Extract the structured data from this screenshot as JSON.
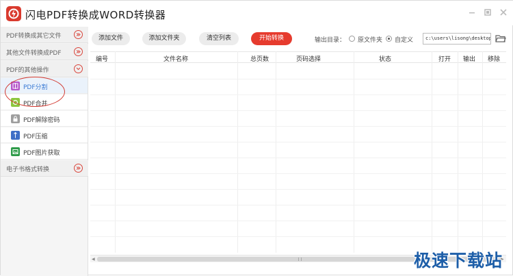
{
  "app": {
    "title": "闪电PDF转换成WORD转换器"
  },
  "sidebar": {
    "sections": [
      {
        "label": "PDF转换成其它文件"
      },
      {
        "label": "其他文件转换成PDF"
      },
      {
        "label": "PDF的其他操作"
      },
      {
        "label": "电子书格式转换"
      }
    ],
    "items": [
      {
        "label": "PDF分割",
        "icon": "split-icon",
        "color": "#b657c9",
        "active": true
      },
      {
        "label": "PDF合并",
        "icon": "merge-icon",
        "color": "#8dc63f",
        "active": false
      },
      {
        "label": "PDF解除密码",
        "icon": "lock-icon",
        "color": "#9e9e9e",
        "active": false
      },
      {
        "label": "PDF压缩",
        "icon": "compress-icon",
        "color": "#3f6fc6",
        "active": false
      },
      {
        "label": "PDF图片获取",
        "icon": "image-extract-icon",
        "color": "#2e9b49",
        "active": false
      }
    ]
  },
  "toolbar": {
    "add_file": "添加文件",
    "add_folder": "添加文件夹",
    "clear_list": "清空列表",
    "start": "开始转换",
    "output_label": "输出目录：",
    "radio_original": "原文件夹",
    "radio_custom": "自定义",
    "selected_output": "自定义",
    "output_path": "c:\\users\\lisong\\desktop"
  },
  "table": {
    "columns": [
      "编号",
      "文件名称",
      "总页数",
      "页码选择",
      "状态",
      "打开",
      "输出",
      "移除"
    ],
    "rows": []
  },
  "watermark": "极速下载站",
  "colors": {
    "accent": "#e63b2e",
    "highlight_ring": "#d23a32",
    "active_item_text": "#3a7bd5",
    "watermark": "#1d5ea8"
  }
}
